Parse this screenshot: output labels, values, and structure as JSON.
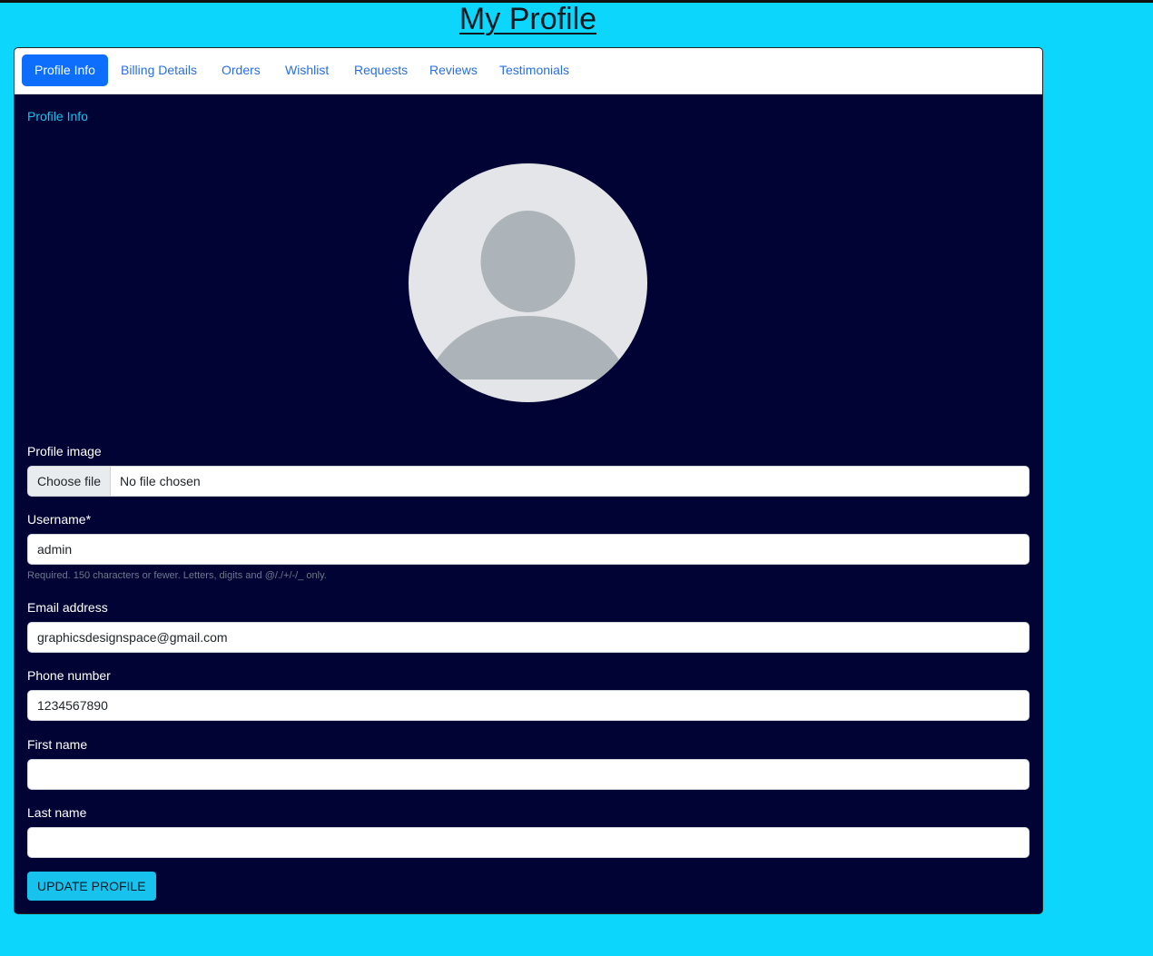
{
  "page": {
    "title": "My Profile"
  },
  "tabs": [
    {
      "label": "Profile Info",
      "active": true
    },
    {
      "label": "Billing Details",
      "active": false
    },
    {
      "label": "Orders",
      "active": false
    },
    {
      "label": "Wishlist",
      "active": false
    },
    {
      "label": "Requests",
      "active": false
    },
    {
      "label": "Reviews",
      "active": false
    },
    {
      "label": "Testimonials",
      "active": false
    }
  ],
  "section": {
    "heading": "Profile Info"
  },
  "avatar": {
    "icon": "default-user-avatar-icon"
  },
  "form": {
    "profile_image": {
      "label": "Profile image",
      "button": "Choose file",
      "status": "No file chosen"
    },
    "username": {
      "label": "Username*",
      "value": "admin",
      "help": "Required. 150 characters or fewer. Letters, digits and @/./+/-/_ only."
    },
    "email": {
      "label": "Email address",
      "value": "graphicsdesignspace@gmail.com"
    },
    "phone": {
      "label": "Phone number",
      "value": "1234567890"
    },
    "first_name": {
      "label": "First name",
      "value": ""
    },
    "last_name": {
      "label": "Last name",
      "value": ""
    },
    "submit_label": "UPDATE PROFILE"
  },
  "colors": {
    "page_bg": "#0dd6fc",
    "card_bg": "#000333",
    "active_tab": "#0d6efd",
    "link": "#2a6fe0",
    "section_link": "#13c5f0",
    "submit_bg": "#17c2ec"
  }
}
